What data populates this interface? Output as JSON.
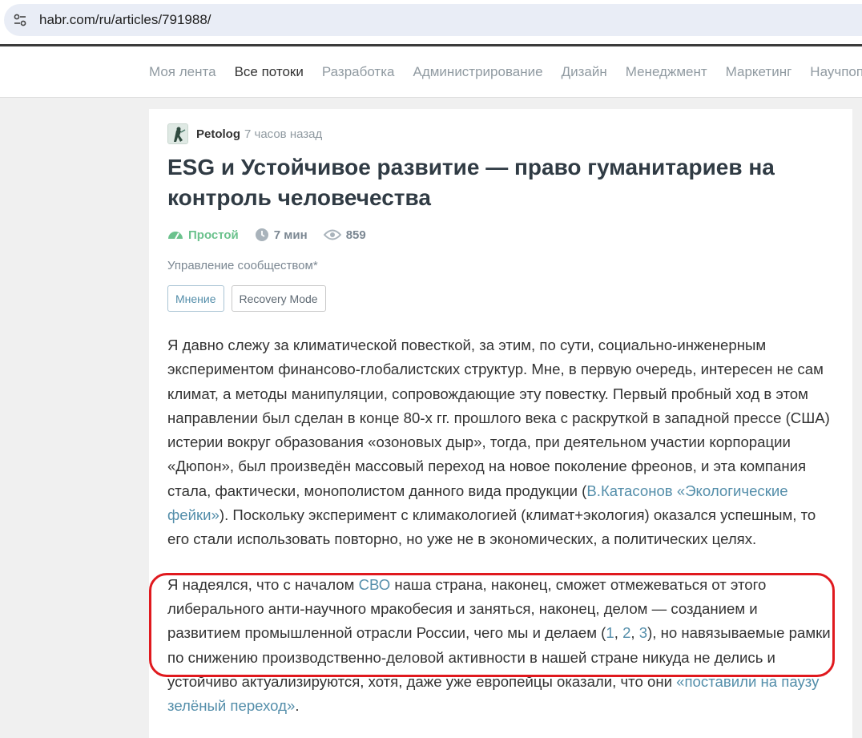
{
  "browser": {
    "url": "habr.com/ru/articles/791988/"
  },
  "nav": {
    "items": [
      {
        "label": "Моя лента",
        "active": false
      },
      {
        "label": "Все потоки",
        "active": true
      },
      {
        "label": "Разработка",
        "active": false
      },
      {
        "label": "Администрирование",
        "active": false
      },
      {
        "label": "Дизайн",
        "active": false
      },
      {
        "label": "Менеджмент",
        "active": false
      },
      {
        "label": "Маркетинг",
        "active": false
      },
      {
        "label": "Научпоп",
        "active": false
      }
    ]
  },
  "article": {
    "author": "Petolog",
    "time": "7 часов назад",
    "title": "ESG и Устойчивое развитие — право гуманитариев на контроль человечества",
    "complexity": "Простой",
    "read_time": "7 мин",
    "views": "859",
    "hub": "Управление сообществом*",
    "tags": [
      "Мнение",
      "Recovery Mode"
    ],
    "p1": {
      "t1": "Я давно слежу за климатической повесткой, за этим, по сути, социально-инженерным экспериментом финансово-глобалистских структур. Мне, в первую очередь, интересен не сам климат, а методы манипуляции, сопровождающие эту повестку. Первый пробный ход в этом направлении был сделан в конце 80-х гг. прошлого века с раскруткой в западной прессе (США) истерии вокруг образования «озоновых дыр», тогда, при деятельном участии корпорации «Дюпон», был произведён массовый переход на новое поколение фреонов, и эта компания стала, фактически, монополистом данного вида продукции (",
      "link1": "В.Катасонов «Экологические фейки»",
      "t2": "). Поскольку эксперимент с климакологией (климат+экология) оказался успешным, то его стали использовать повторно, но уже не в экономических, а политических целях."
    },
    "p2": {
      "t1": "Я надеялся, что с началом ",
      "link_svo": "СВО",
      "t2": " наша страна, наконец, сможет отмежеваться от этого либерального анти-научного мракобесия и заняться, наконец, делом — созданием и развитием промышленной отрасли России, чего мы и делаем (",
      "ref1": "1",
      "sep1": ", ",
      "ref2": "2",
      "sep2": ", ",
      "ref3": "3",
      "t3": "), но навязываемые рамки по снижению производственно-деловой активности в нашей стране никуда не делись и устойчиво актуализируются, хотя, даже уже европейцы оказали, что они ",
      "link_pause": "«поставили на паузу зелёный переход»",
      "t4": "."
    }
  },
  "colors": {
    "link": "#548eaa",
    "complexity": "#6bc28d",
    "highlight": "#e0191e"
  }
}
